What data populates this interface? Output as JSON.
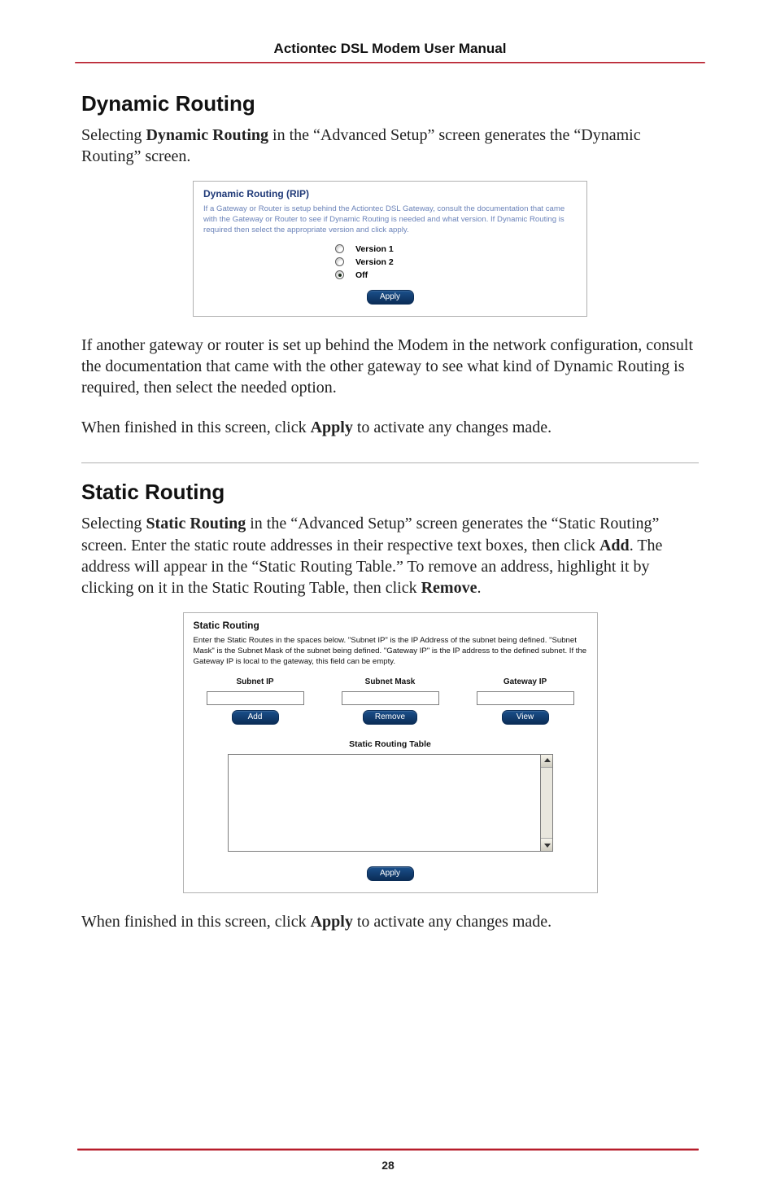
{
  "header": {
    "running_title": "Actiontec DSL Modem User Manual"
  },
  "sections": {
    "dynamic_routing": {
      "heading": "Dynamic Routing",
      "intro_pre": "Selecting ",
      "intro_bold": "Dynamic Routing",
      "intro_post": " in the “Advanced Setup” screen generates the “Dynamic Routing” screen.",
      "after_pre": "If another gateway or router is set up behind the Modem in the network configuration, consult the documentation that came with the other gateway to see what kind of Dynamic Routing is required, then select the needed option.",
      "apply_pre": "When finished in this screen, click ",
      "apply_bold": "Apply",
      "apply_post": " to activate any changes made."
    },
    "static_routing": {
      "heading": "Static Routing",
      "intro_pre": "Selecting ",
      "intro_bold1": "Static Routing",
      "intro_mid1": " in the “Advanced Setup” screen generates the “Static Routing” screen. Enter the static route addresses in their respective text boxes, then click ",
      "intro_bold2": "Add",
      "intro_mid2": ". The address will appear in the “Static Routing Table.” To remove an address, highlight it by clicking on it in the Static Routing Table, then click ",
      "intro_bold3": "Remove",
      "intro_post": ".",
      "apply_pre": "When finished in this screen, click ",
      "apply_bold": "Apply",
      "apply_post": " to activate any changes made."
    }
  },
  "figure_rip": {
    "title": "Dynamic Routing (RIP)",
    "blurb": "If a Gateway or Router is setup behind the Actiontec DSL Gateway, consult the documentation that came with the Gateway or Router to see if Dynamic Routing is needed and what version. If Dynamic Routing is required then select the appropriate version and click apply.",
    "options": {
      "v1": "Version 1",
      "v2": "Version 2",
      "off": "Off"
    },
    "apply_label": "Apply"
  },
  "figure_sr": {
    "title": "Static Routing",
    "blurb": "Enter the Static Routes in the spaces below. \"Subnet IP\" is the IP Address of the subnet being defined. \"Subnet Mask\" is the Subnet Mask of the subnet being defined. \"Gateway IP\" is the IP address to the defined subnet. If the Gateway IP is local to the gateway, this field can be empty.",
    "columns": {
      "subnet_ip": "Subnet IP",
      "subnet_mask": "Subnet Mask",
      "gateway_ip": "Gateway IP"
    },
    "buttons": {
      "add": "Add",
      "remove": "Remove",
      "view": "View",
      "apply": "Apply"
    },
    "table_heading": "Static Routing Table"
  },
  "footer": {
    "page_number": "28"
  }
}
